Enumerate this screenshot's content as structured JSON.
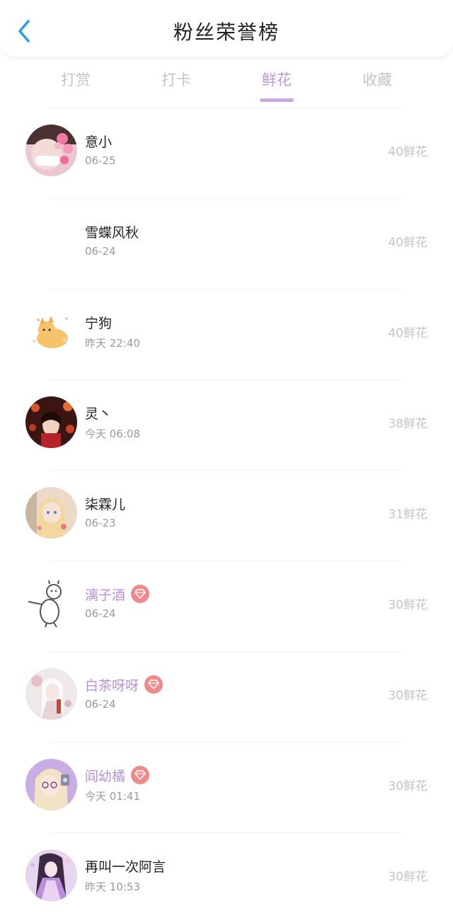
{
  "header": {
    "title": "粉丝荣誉榜",
    "back_icon": "chevron-left-icon",
    "accent_color": "#2f9bea"
  },
  "tabs": [
    {
      "label": "打赏",
      "active": false
    },
    {
      "label": "打卡",
      "active": false
    },
    {
      "label": "鲜花",
      "active": true
    },
    {
      "label": "收藏",
      "active": false
    }
  ],
  "colors": {
    "active_tab": "#b99ad8",
    "vip_name": "#b88fd8",
    "vip_badge": "#f08a8a"
  },
  "list": [
    {
      "name": "意小",
      "time": "06-25",
      "amount": "40鲜花",
      "vip": false,
      "avatar": "avatar-pink-flower-girl"
    },
    {
      "name": "雪蝶风秋",
      "time": "06-24",
      "amount": "40鲜花",
      "vip": false,
      "avatar": "avatar-blank"
    },
    {
      "name": "宁狗",
      "time": "昨天 22:40",
      "amount": "40鲜花",
      "vip": false,
      "avatar": "avatar-cartoon-cat"
    },
    {
      "name": "灵丶",
      "time": "今天 06:08",
      "amount": "38鲜花",
      "vip": false,
      "avatar": "avatar-dark-red-girl"
    },
    {
      "name": "柒霖儿",
      "time": "06-23",
      "amount": "31鲜花",
      "vip": false,
      "avatar": "avatar-anime-girl"
    },
    {
      "name": "漓子酒",
      "time": "06-24",
      "amount": "30鲜花",
      "vip": true,
      "avatar": "avatar-doodle-figure"
    },
    {
      "name": "白茶呀呀",
      "time": "06-24",
      "amount": "30鲜花",
      "vip": true,
      "avatar": "avatar-white-hanfu-girl"
    },
    {
      "name": "阎幼橘",
      "time": "今天 01:41",
      "amount": "30鲜花",
      "vip": true,
      "avatar": "avatar-pastel-girl"
    },
    {
      "name": "再叫一次阿言",
      "time": "昨天 10:53",
      "amount": "30鲜花",
      "vip": false,
      "avatar": "avatar-purple-hanfu"
    }
  ]
}
